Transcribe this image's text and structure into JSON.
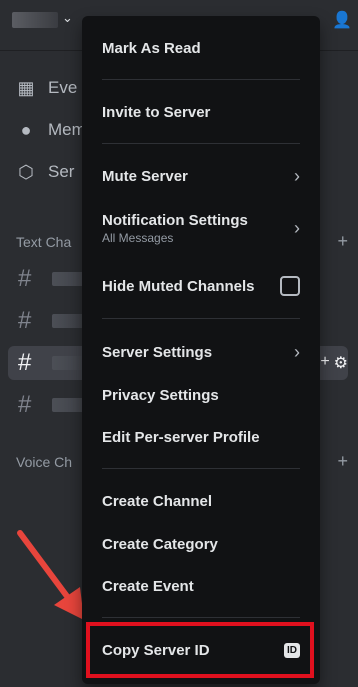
{
  "sidebar": {
    "quick_links": [
      {
        "label": "Eve",
        "icon": "calendar-icon"
      },
      {
        "label": "Mem",
        "icon": "members-icon"
      },
      {
        "label": "Ser",
        "icon": "boost-icon"
      }
    ],
    "text_category": "Text Cha",
    "voice_category": "Voice Ch"
  },
  "menu": {
    "mark_as_read": "Mark As Read",
    "invite": "Invite to Server",
    "mute": "Mute Server",
    "notification_settings": "Notification Settings",
    "notification_sub": "All Messages",
    "hide_muted": "Hide Muted Channels",
    "server_settings": "Server Settings",
    "privacy_settings": "Privacy Settings",
    "edit_profile": "Edit Per-server Profile",
    "create_channel": "Create Channel",
    "create_category": "Create Category",
    "create_event": "Create Event",
    "copy_id": "Copy Server ID",
    "id_badge": "ID"
  },
  "colors": {
    "highlight": "#e0101e",
    "arrow": "#e8453c"
  }
}
